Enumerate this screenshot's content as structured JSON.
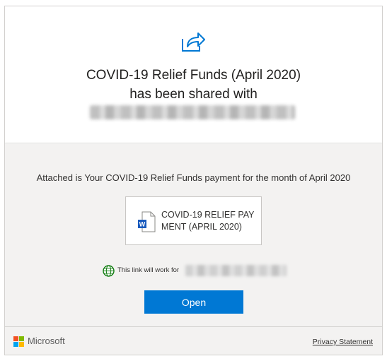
{
  "header": {
    "title_line1": "COVID-19 Relief Funds (April 2020)",
    "title_line2": "has been shared with"
  },
  "body": {
    "message": "Attached is Your COVID-19 Relief Funds payment for the month of April 2020",
    "file": {
      "name": "COVID-19 RELIEF PAYMENT (APRIL 2020)",
      "icon": "word-document-icon"
    },
    "link_note": "This link will work for",
    "open_button": "Open"
  },
  "footer": {
    "brand": "Microsoft",
    "privacy_link": "Privacy Statement"
  },
  "colors": {
    "accent": "#0078d4",
    "word_blue": "#185abd",
    "globe_green": "#107c10",
    "panel_bg": "#f3f2f1"
  }
}
